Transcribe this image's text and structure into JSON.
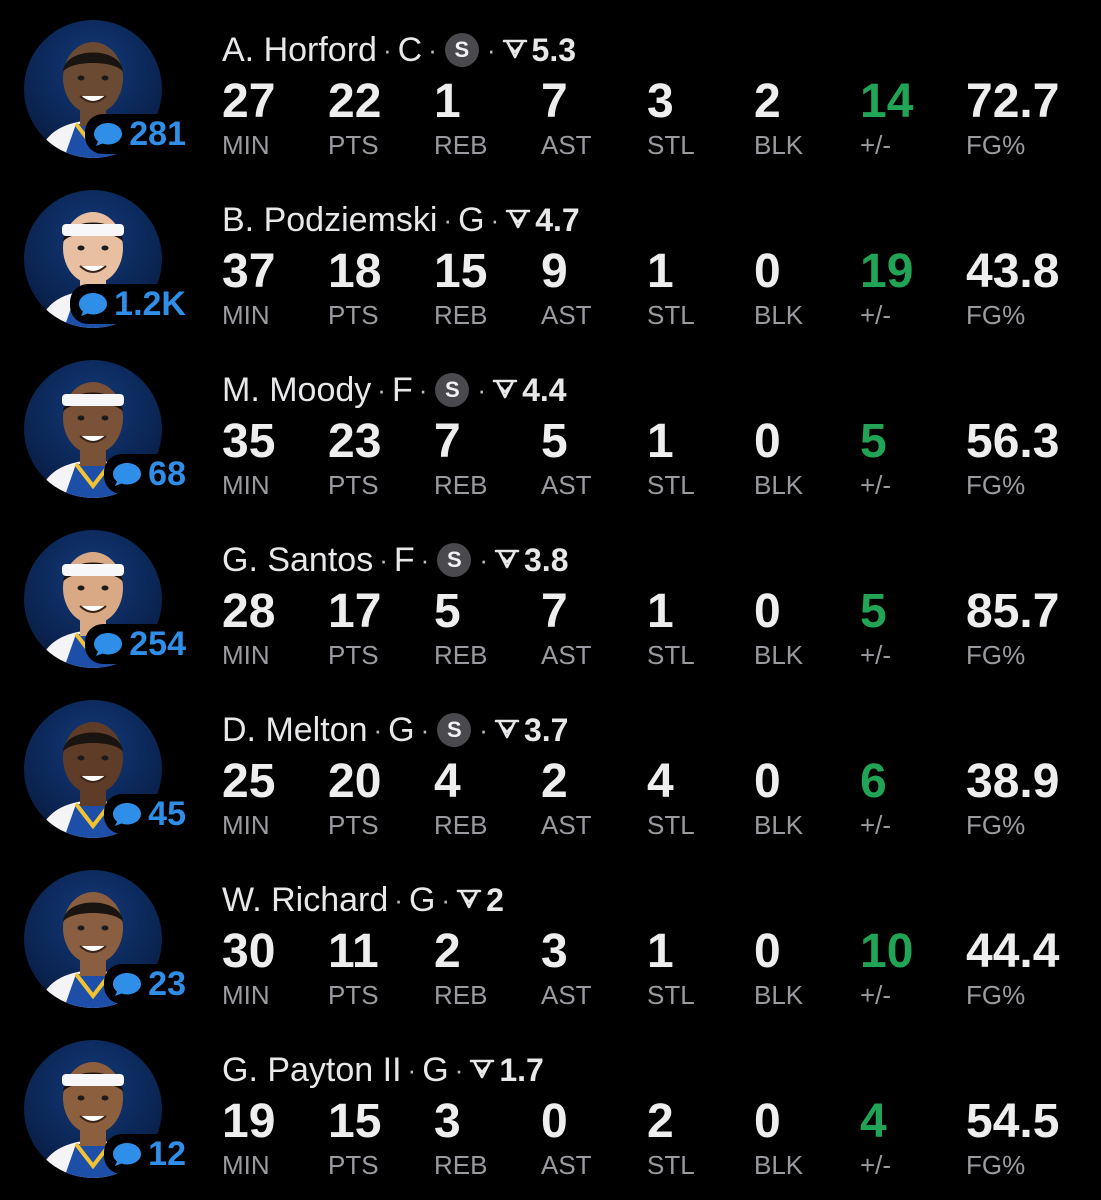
{
  "colors": {
    "background": "#000000",
    "text": "#eeeeef",
    "label": "#9a9aa0",
    "plus_minus_positive": "#21a455",
    "comment_blue": "#2f8fe8",
    "starter_badge": "#4a4a4e",
    "avatar_bg": "#0b2452"
  },
  "icons": {
    "comment": "speech-bubble-icon",
    "rating": "pulse-chevron-icon",
    "starter": "starter-badge"
  },
  "stat_labels": [
    "MIN",
    "PTS",
    "REB",
    "AST",
    "STL",
    "BLK",
    "+/-",
    "FG%"
  ],
  "players": [
    {
      "name": "A. Horford",
      "position": "C",
      "starter": true,
      "starter_label": "S",
      "rating": "5.3",
      "comments": "281",
      "stats": [
        "27",
        "22",
        "1",
        "7",
        "3",
        "2",
        "14",
        "72.7"
      ],
      "skin": "#6b4a34",
      "headband": false
    },
    {
      "name": "B. Podziemski",
      "position": "G",
      "starter": false,
      "starter_label": "",
      "rating": "4.7",
      "comments": "1.2K",
      "stats": [
        "37",
        "18",
        "15",
        "9",
        "1",
        "0",
        "19",
        "43.8"
      ],
      "skin": "#e8bfa0",
      "headband": true
    },
    {
      "name": "M. Moody",
      "position": "F",
      "starter": true,
      "starter_label": "S",
      "rating": "4.4",
      "comments": "68",
      "stats": [
        "35",
        "23",
        "7",
        "5",
        "1",
        "0",
        "5",
        "56.3"
      ],
      "skin": "#7a5238",
      "headband": true
    },
    {
      "name": "G. Santos",
      "position": "F",
      "starter": true,
      "starter_label": "S",
      "rating": "3.8",
      "comments": "254",
      "stats": [
        "28",
        "17",
        "5",
        "7",
        "1",
        "0",
        "5",
        "85.7"
      ],
      "skin": "#d9a884",
      "headband": true
    },
    {
      "name": "D. Melton",
      "position": "G",
      "starter": true,
      "starter_label": "S",
      "rating": "3.7",
      "comments": "45",
      "stats": [
        "25",
        "20",
        "4",
        "2",
        "4",
        "0",
        "6",
        "38.9"
      ],
      "skin": "#5e3c28",
      "headband": false
    },
    {
      "name": "W. Richard",
      "position": "G",
      "starter": false,
      "starter_label": "",
      "rating": "2",
      "comments": "23",
      "stats": [
        "30",
        "11",
        "2",
        "3",
        "1",
        "0",
        "10",
        "44.4"
      ],
      "skin": "#8a5e40",
      "headband": false
    },
    {
      "name": "G. Payton II",
      "position": "G",
      "starter": false,
      "starter_label": "",
      "rating": "1.7",
      "comments": "12",
      "stats": [
        "19",
        "15",
        "3",
        "0",
        "2",
        "0",
        "4",
        "54.5"
      ],
      "skin": "#8c603f",
      "headband": true
    }
  ]
}
